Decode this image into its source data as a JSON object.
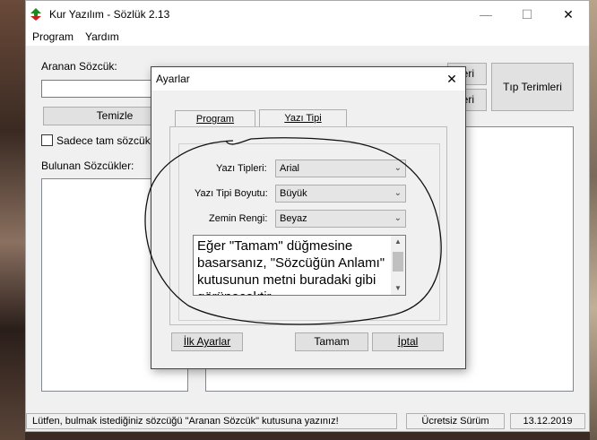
{
  "window": {
    "title": "Kur Yazılım - Sözlük 2.13"
  },
  "menu": {
    "items": [
      "Program",
      "Yardım"
    ]
  },
  "main": {
    "search_label": "Aranan Sözcük:",
    "search_value": "",
    "clear_button": "Temizle",
    "exact_checkbox_label": "Sadece tam sözcük bu",
    "found_label": "Bulunan Sözcükler:",
    "btn_partial_1": "leri",
    "btn_partial_2": "leri",
    "terms_button": "Tıp Terimleri"
  },
  "dialog": {
    "title": "Ayarlar",
    "tabs": [
      "Program",
      "Yazı Tipi"
    ],
    "active_tab": "Yazı Tipi",
    "font_label": "Yazı Tipleri:",
    "font_value": "Arial",
    "size_label": "Yazı Tipi Boyutu:",
    "size_value": "Büyük",
    "bg_label": "Zemin Rengi:",
    "bg_value": "Beyaz",
    "preview_text": "Eğer \"Tamam\" düğmesine basarsanız, \"Sözcüğün Anlamı\" kutusunun metni buradaki gibi görünecektir.",
    "reset_button": "İlk Ayarlar",
    "ok_button": "Tamam",
    "cancel_button": "İptal"
  },
  "status": {
    "message": "Lütfen, bulmak istediğiniz sözcüğü \"Aranan Sözcük\" kutusuna yazınız!",
    "edition": "Ücretsiz Sürüm",
    "date": "13.12.2019"
  },
  "colors": {
    "accent": "#000000",
    "titlebar_bg": "#ffffff",
    "window_bg": "#f0f0f0",
    "icon_green": "#1e8a1e",
    "icon_red": "#c81e1e"
  }
}
